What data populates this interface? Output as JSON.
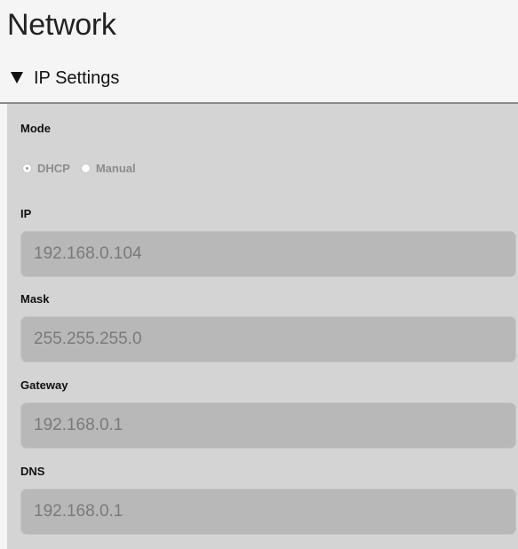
{
  "page": {
    "title": "Network"
  },
  "section": {
    "label": "IP Settings",
    "expanded": true,
    "toggle_icon": "triangle-down-icon"
  },
  "mode": {
    "label": "Mode",
    "options": [
      {
        "label": "DHCP",
        "selected": true
      },
      {
        "label": "Manual",
        "selected": false
      }
    ]
  },
  "fields": {
    "ip": {
      "label": "IP",
      "value": "192.168.0.104"
    },
    "mask": {
      "label": "Mask",
      "value": "255.255.255.0"
    },
    "gateway": {
      "label": "Gateway",
      "value": "192.168.0.1"
    },
    "dns": {
      "label": "DNS",
      "value": "192.168.0.1"
    }
  },
  "colors": {
    "panel_background": "#d4d4d4",
    "input_background": "#b8b8b8",
    "disabled_text": "#7a7a7a",
    "header_divider": "#8a8a8a"
  }
}
